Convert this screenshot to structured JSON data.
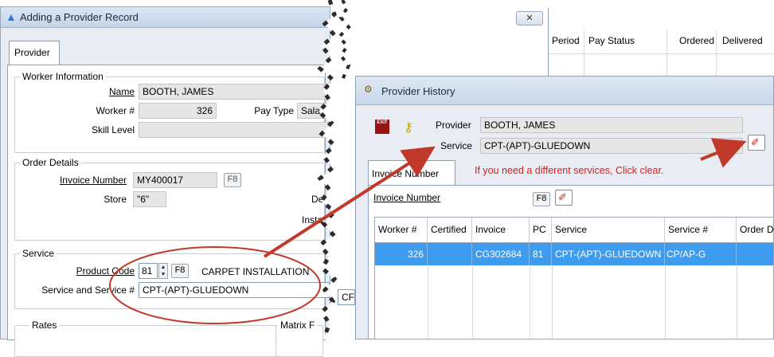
{
  "left_dialog": {
    "title": "Adding a Provider Record",
    "close_label": "✕",
    "tab": "Provider",
    "worker_info": {
      "group_title": "Worker Information",
      "name_label": "Name",
      "name_value": "BOOTH, JAMES",
      "worker_label": "Worker #",
      "worker_value": "326",
      "pay_type_label": "Pay Type",
      "pay_type_value": "Salarie",
      "skill_label": "Skill Level",
      "skill_value": ""
    },
    "order_details": {
      "group_title": "Order Details",
      "invoice_label": "Invoice Number",
      "invoice_value": "MY400017",
      "invoice_key": "F8",
      "store_label": "Store",
      "store_value": "\"6\"",
      "extra1": "De",
      "extra2": "Insta"
    },
    "service": {
      "group_title": "Service",
      "product_label": "Product Code",
      "product_value": "81",
      "product_key": "F8",
      "product_desc": "CARPET INSTALLATION",
      "svc_label": "Service and Service #",
      "svc_value": "CPT-(APT)-GLUEDOWN",
      "svc_extra": "CF"
    },
    "rates": {
      "group_title": "Rates",
      "matrix": "Matrix F"
    }
  },
  "background_window": {
    "columns": [
      "Period",
      "Pay Status",
      "Ordered",
      "Delivered"
    ]
  },
  "history": {
    "title": "Provider History",
    "exit_label": "EXIT",
    "provider_label": "Provider",
    "provider_value": "BOOTH, JAMES",
    "service_label": "Service",
    "service_value": "CPT-(APT)-GLUEDOWN",
    "tab": "Invoice Number",
    "annotation": "If you need a different services, Click clear.",
    "invoice_label": "Invoice Number",
    "invoice_key": "F8",
    "grid": {
      "headers": [
        "Worker #",
        "Certified",
        "Invoice",
        "PC",
        "Service",
        "Service #",
        "Order D"
      ],
      "row": [
        "326",
        "",
        "CG302684",
        "81",
        "CPT-(APT)-GLUEDOWN",
        "CP/AP-G",
        ""
      ]
    }
  },
  "colors": {
    "selection": "#3d9cf0",
    "annotation": "#d42020",
    "highlight_circle": "#c0392b"
  }
}
